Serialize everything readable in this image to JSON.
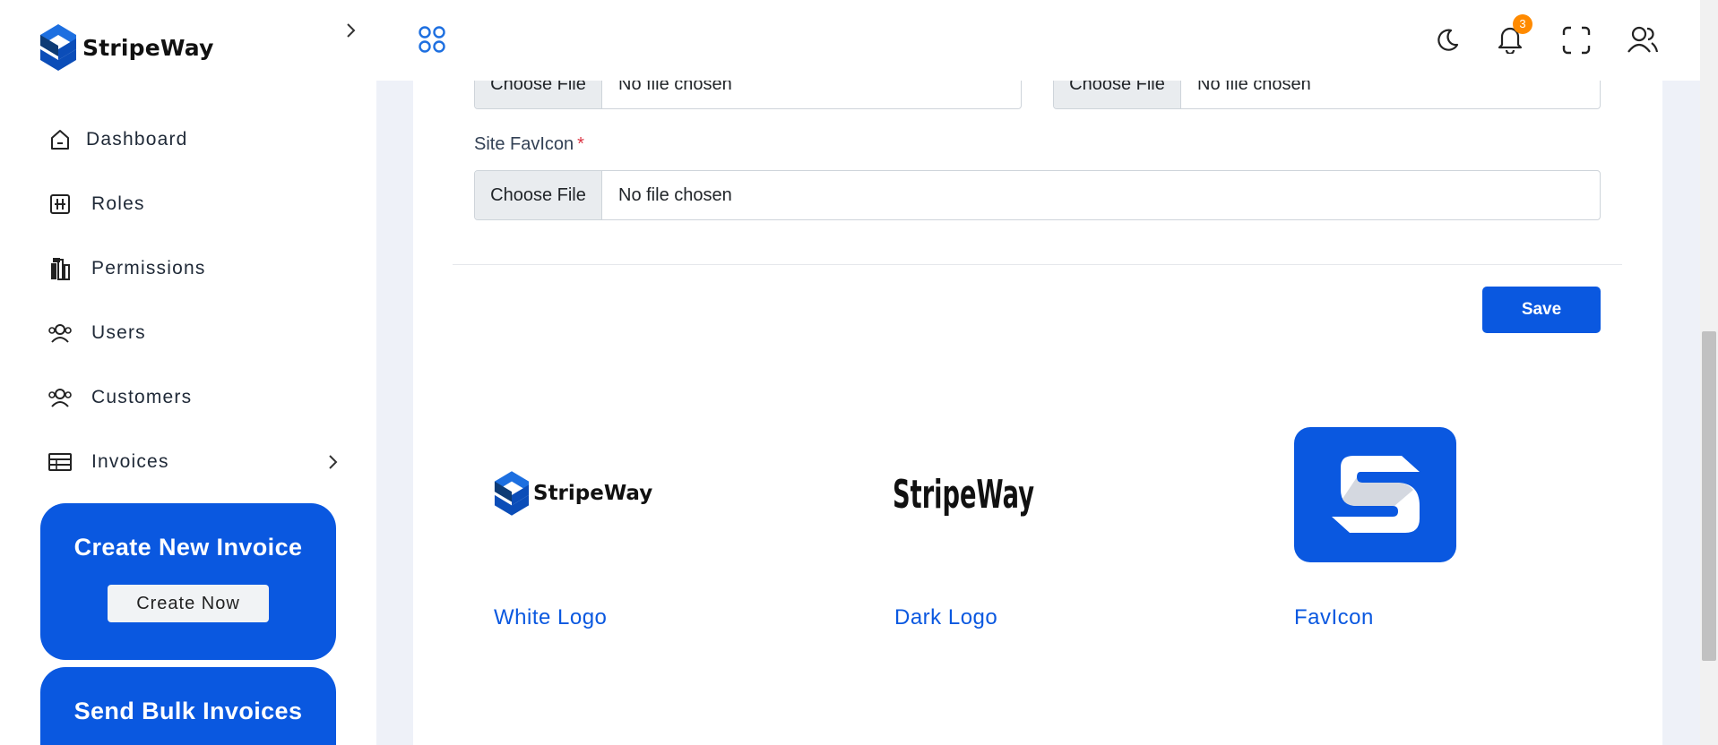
{
  "brand": {
    "name": "StripeWay"
  },
  "sidebar": {
    "items": [
      {
        "label": "Dashboard",
        "icon": "dashboard-icon"
      },
      {
        "label": "Roles",
        "icon": "roles-icon"
      },
      {
        "label": "Permissions",
        "icon": "permissions-icon"
      },
      {
        "label": "Users",
        "icon": "users-icon"
      },
      {
        "label": "Customers",
        "icon": "customers-icon"
      },
      {
        "label": "Invoices",
        "icon": "invoices-icon",
        "has_submenu": true
      }
    ],
    "promo_create": {
      "title": "Create New Invoice",
      "button": "Create Now"
    },
    "promo_bulk": {
      "title": "Send Bulk Invoices"
    }
  },
  "topbar": {
    "notifications_count": "3",
    "icons": [
      "apps-grid-icon",
      "moon-icon",
      "bell-icon",
      "fullscreen-icon",
      "user-icon"
    ]
  },
  "form": {
    "white_logo_input": {
      "button": "Choose File",
      "status": "No file chosen"
    },
    "dark_logo_input": {
      "button": "Choose File",
      "status": "No file chosen"
    },
    "favicon_label": "Site FavIcon",
    "favicon_required": "*",
    "favicon_input": {
      "button": "Choose File",
      "status": "No file chosen"
    },
    "save_label": "Save"
  },
  "previews": [
    {
      "label": "White Logo"
    },
    {
      "label": "Dark Logo"
    },
    {
      "label": "FavIcon"
    }
  ],
  "colors": {
    "primary": "#0a58e0",
    "badge": "#ff8a00",
    "required": "#dc3545"
  }
}
